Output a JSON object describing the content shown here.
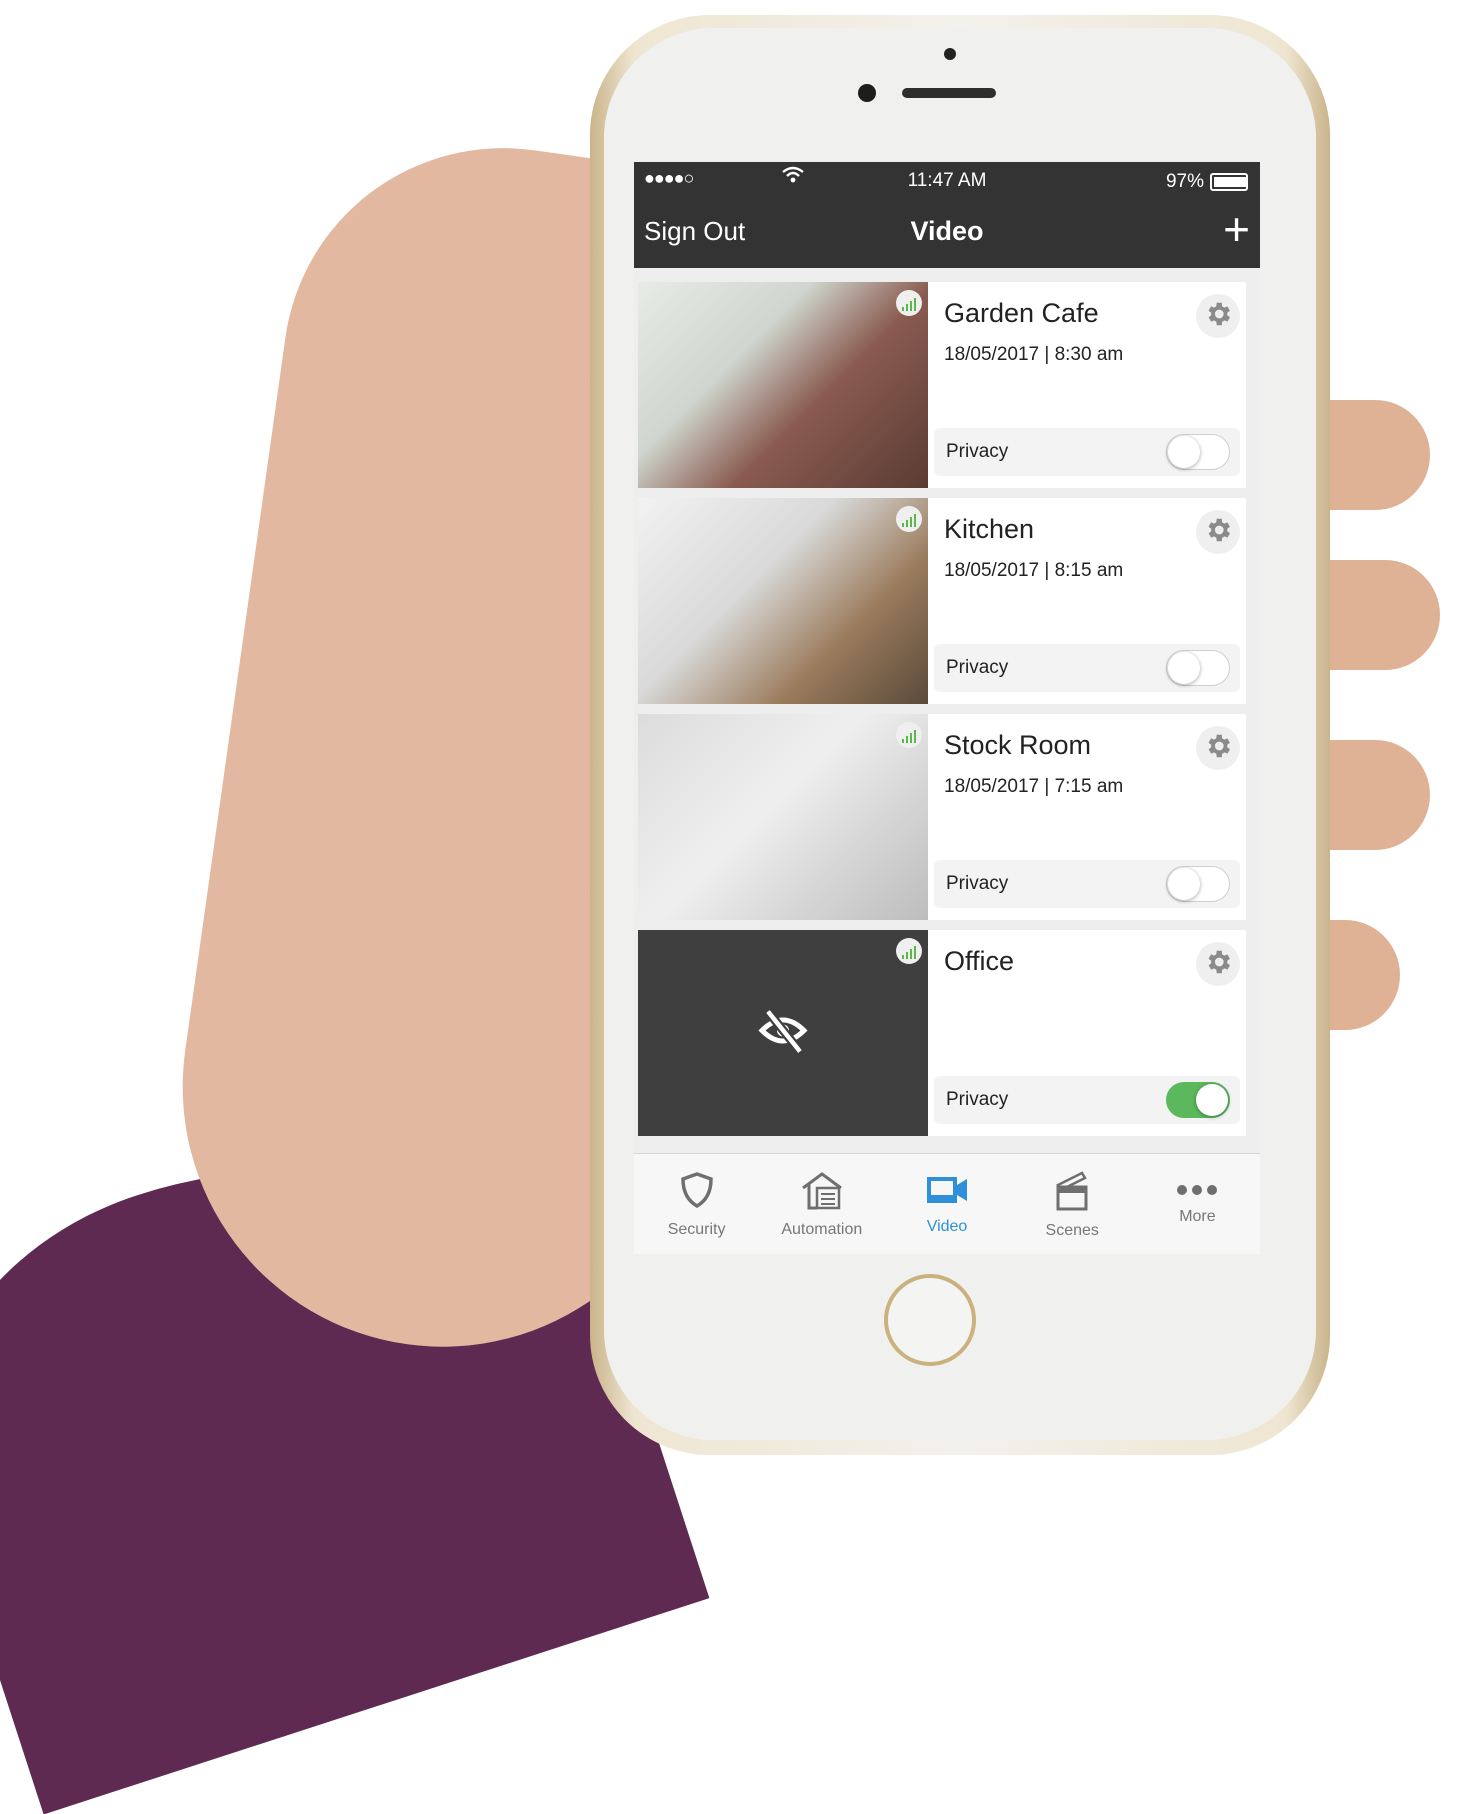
{
  "status_bar": {
    "signal": "●●●●○",
    "time": "11:47 AM",
    "battery": "97%"
  },
  "nav": {
    "left": "Sign Out",
    "title": "Video",
    "add": "+"
  },
  "cameras": [
    {
      "name": "Garden Cafe",
      "timestamp": "18/05/2017 | 8:30 am",
      "privacy_label": "Privacy",
      "privacy_on": false,
      "thumb": "cafe"
    },
    {
      "name": "Kitchen",
      "timestamp": "18/05/2017 | 8:15 am",
      "privacy_label": "Privacy",
      "privacy_on": false,
      "thumb": "kitchen"
    },
    {
      "name": "Stock Room",
      "timestamp": "18/05/2017 | 7:15 am",
      "privacy_label": "Privacy",
      "privacy_on": false,
      "thumb": "stock"
    },
    {
      "name": "Office",
      "timestamp": "",
      "privacy_label": "Privacy",
      "privacy_on": true,
      "thumb": "office"
    }
  ],
  "tabs": [
    {
      "label": "Security",
      "icon": "shield-icon",
      "active": false
    },
    {
      "label": "Automation",
      "icon": "home-automation-icon",
      "active": false
    },
    {
      "label": "Video",
      "icon": "video-camera-icon",
      "active": true
    },
    {
      "label": "Scenes",
      "icon": "clapperboard-icon",
      "active": false
    },
    {
      "label": "More",
      "icon": "more-dots-icon",
      "active": false
    }
  ],
  "colors": {
    "header": "#333333",
    "accent": "#2f8fd8",
    "toggle_on": "#5cb85c",
    "signal": "#5bb84a"
  }
}
